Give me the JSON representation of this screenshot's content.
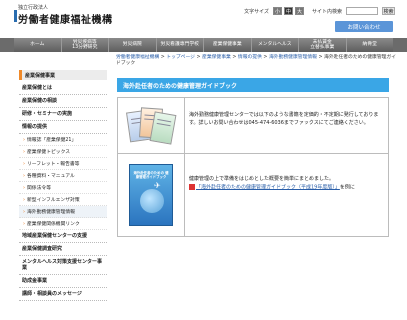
{
  "header": {
    "org_sub": "独立行政法人",
    "org_title": "労働者健康福祉機構",
    "font_size_label": "文字サイズ",
    "font_sizes": [
      "小",
      "中",
      "大"
    ],
    "search_label": "サイト内検索",
    "search_button": "検索",
    "contact_button": "お問い合わせ"
  },
  "nav": {
    "items": [
      "ホーム",
      "労災疾病等\n13分野研究",
      "労災病院",
      "労災看護専門学校",
      "産業保健事業",
      "メンタルヘルス",
      "未払賃金\n立替払事業",
      "納骨堂"
    ]
  },
  "breadcrumb": {
    "items": [
      {
        "text": "労働者健康福祉機構",
        "link": true
      },
      {
        "text": "トップページ",
        "link": true
      },
      {
        "text": "産業保健事業",
        "link": true
      },
      {
        "text": "情報の提供",
        "link": true
      },
      {
        "text": "海外勤務健康管理情報",
        "link": true
      },
      {
        "text": "海外赴任者のための健康管理ガイドブック",
        "link": false
      }
    ],
    "separator": " > "
  },
  "sidebar": {
    "header": "産業保健事業",
    "items": [
      {
        "type": "item",
        "label": "産業保健とは"
      },
      {
        "type": "item",
        "label": "産業保健の相談"
      },
      {
        "type": "item",
        "label": "研修・セミナーの実施"
      },
      {
        "type": "item",
        "label": "情報の提供"
      },
      {
        "type": "sub",
        "label": "情報誌「産業保健21」"
      },
      {
        "type": "sub",
        "label": "産業保健トピックス"
      },
      {
        "type": "sub",
        "label": "リーフレット・報告書等"
      },
      {
        "type": "sub",
        "label": "各種資料・マニュアル"
      },
      {
        "type": "sub",
        "label": "関係法令等"
      },
      {
        "type": "sub",
        "label": "新型インフルエンザ対策"
      },
      {
        "type": "sub",
        "label": "海外勤務健康管理情報",
        "active": true
      },
      {
        "type": "sub",
        "label": "産業保健関係機関リンク"
      },
      {
        "type": "item",
        "label": "地域産業保健センターの支援"
      },
      {
        "type": "item",
        "label": "産業保健調査研究"
      },
      {
        "type": "item",
        "label": "メンタルヘルス対策支援センター事業",
        "tall": true
      },
      {
        "type": "item",
        "label": "助成金事業"
      },
      {
        "type": "item",
        "label": "講師・相談員のメッセージ"
      }
    ]
  },
  "main": {
    "title": "海外赴任者のための健康管理ガイドブック",
    "row1_text": "海外勤務健康管理センターでは以下のような書籍を定価的・不定期に発行しております。詳しいお問い合わせは045-474-6036までファックスにてご連絡ください。",
    "row2_text_before": "健康管理の上で準備をはじめとした概要を簡単にまとめました。",
    "row2_link": "「海外赴任者のための健康管理ガイドブック（平成19年度版）」",
    "row2_text_after": "を例に",
    "guide_cover_title": "海外赴任者のための 健康管理ガイドブック"
  }
}
